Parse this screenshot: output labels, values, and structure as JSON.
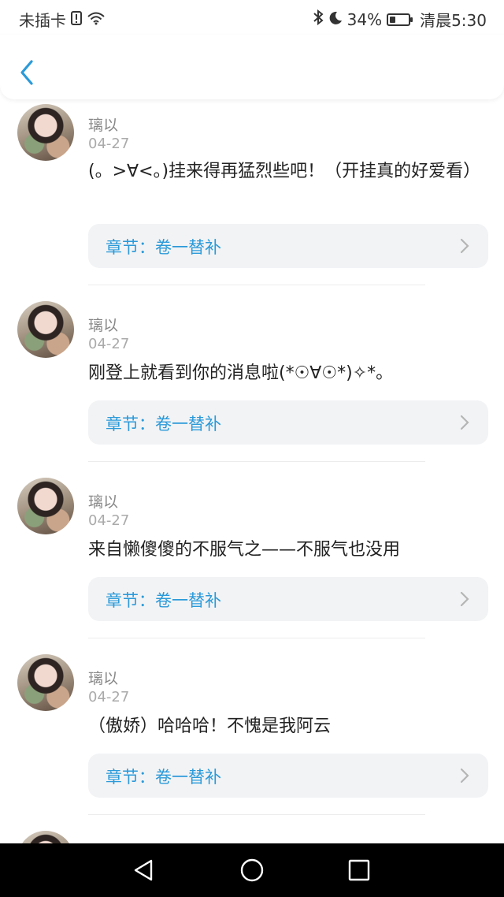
{
  "status": {
    "carrier": "未插卡",
    "battery_percent": "34%",
    "battery_level": 0.34,
    "time": "清晨5:30"
  },
  "comments": [
    {
      "name": "璃以",
      "date": "04-27",
      "text": "(。>∀<。)挂来得再猛烈些吧！（开挂真的好爱看）",
      "chapter": "章节：卷一替补"
    },
    {
      "name": "璃以",
      "date": "04-27",
      "text": "刚登上就看到你的消息啦(*☉∀☉*)✧*。",
      "chapter": "章节：卷一替补"
    },
    {
      "name": "璃以",
      "date": "04-27",
      "text": "来自懒傻傻的不服气之——不服气也没用",
      "chapter": "章节：卷一替补"
    },
    {
      "name": "璃以",
      "date": "04-27",
      "text": "（傲娇）哈哈哈！不愧是我阿云",
      "chapter": "章节：卷一替补"
    }
  ]
}
